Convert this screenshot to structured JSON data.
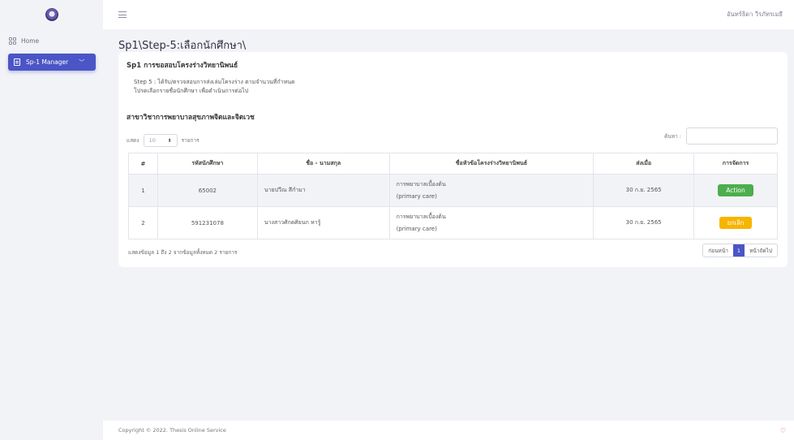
{
  "topbar": {
    "user_name": "อันทร์ธิดา วีรภัทรเมธี"
  },
  "sidebar": {
    "home_label": "Home",
    "sp_manager_label": "Sp-1 Manager"
  },
  "page": {
    "title": "Sp1\\Step-5:เลือกนักศึกษา\\",
    "card_title": "Sp1 การขอสอบโครงร่างวิทยานิพนธ์",
    "step_line1": "Step 5 : ได้รับ/ตรวจสอบการส่งเล่มโครงร่าง ตามจำนวนที่กำหนด",
    "step_line2": "โปรดเลือกรายชื่อนักศึกษา เพื่อดำเนินการต่อไป",
    "dept_title": "สาขาวิชาการพยาบาลสุขภาพจิตและจิตเวช"
  },
  "table_controls": {
    "show_label": "แสดง",
    "page_length": "10",
    "entries_label": "รายการ",
    "search_label": "ค้นหา :"
  },
  "table": {
    "headers": [
      "#",
      "รหัสนักศึกษา",
      "ชื่อ - นามสกุล",
      "ชื่อหัวข้อโครงร่างวิทยานิพนธ์",
      "ส่งเมื่อ",
      "การจัดการ"
    ],
    "rows": [
      {
        "num": "1",
        "student_id": "65002",
        "name": "นายปวีณ สีกำมา",
        "topic_line1": "การพยาบาลเบื้องต้น",
        "topic_line2": "(primary care)",
        "submitted": "30 ก.ย. 2565",
        "action_label": "Action",
        "action_color": "#4cae4c"
      },
      {
        "num": "2",
        "student_id": "591231078",
        "name": "นางสาวศักดศิยนก หารู้",
        "topic_line1": "การพยาบาลเบื้องต้น",
        "topic_line2": "(primary care)",
        "submitted": "30 ก.ย. 2565",
        "action_label": "ยกเลิก",
        "action_color": "#f7b500"
      }
    ]
  },
  "table_footer": {
    "info": "แสดงข้อมูล 1 ถึง 2 จากข้อมูลทั้งหมด 2 รายการ",
    "prev_label": "ก่อนหน้า",
    "current_page": "1",
    "next_label": "หน้าถัดไป"
  },
  "footer": {
    "copyright": "Copyright © 2022. Thesis Online Service"
  },
  "colors": {
    "accent": "#4b55c6",
    "success": "#4cae4c",
    "warning": "#f7b500"
  }
}
